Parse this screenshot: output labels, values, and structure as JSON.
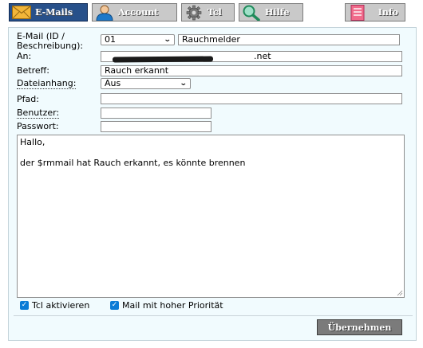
{
  "tabs": [
    {
      "label": "E-Mails",
      "icon": "envelope-icon",
      "active": true
    },
    {
      "label": "Account",
      "icon": "user-icon",
      "active": false
    },
    {
      "label": "Tcl",
      "icon": "gear-icon",
      "active": false
    },
    {
      "label": "Hilfe",
      "icon": "magnifier-icon",
      "active": false
    },
    {
      "label": "Info",
      "icon": "document-icon",
      "active": false
    }
  ],
  "form": {
    "email_label_line1": "E-Mail (ID /",
    "email_label_line2": "Beschreibung):",
    "email_id": "01",
    "email_description": "Rauchmelder",
    "an_label": "An:",
    "an_value_visible_suffix": ".net",
    "betreff_label": "Betreff:",
    "betreff_value": "Rauch erkannt",
    "dateianhang_label": "Dateianhang:",
    "dateianhang_value": "Aus",
    "pfad_label": "Pfad:",
    "pfad_value": "",
    "benutzer_label": "Benutzer:",
    "benutzer_value": "",
    "passwort_label": "Passwort:",
    "passwort_value": "",
    "message_line1": "Hallo,",
    "message_line2": "",
    "message_line3": "der $rmmail hat Rauch erkannt, es könnte brennen",
    "tcl_checkbox_label": "Tcl aktivieren",
    "tcl_checked": true,
    "priority_checkbox_label": "Mail mit hoher Priorität",
    "priority_checked": true,
    "submit_label": "Übernehmen"
  },
  "colors": {
    "active_tab": "#27508a",
    "inactive_tab": "#c9c9c9",
    "panel_bg": "#f1fbfe",
    "checkbox": "#0a7bd6",
    "submit_bg": "#7b7b7b"
  }
}
